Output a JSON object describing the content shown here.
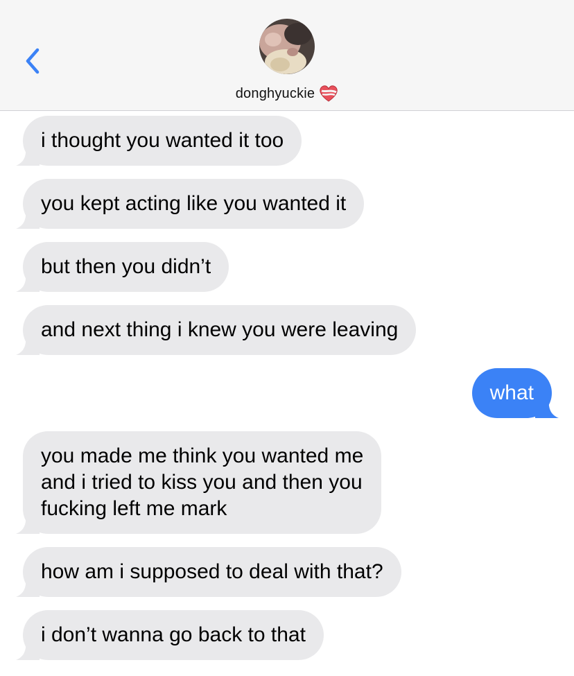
{
  "header": {
    "contact_name": "donghyuckie",
    "back_icon": "chevron-left-icon",
    "heart_icon": "heart-ribbon-icon",
    "accent_color": "#3b82f6"
  },
  "messages": [
    {
      "sender": "contact",
      "text": "i thought you wanted it too"
    },
    {
      "sender": "contact",
      "text": "you kept acting like you wanted it"
    },
    {
      "sender": "contact",
      "text": "but then you didn’t"
    },
    {
      "sender": "contact",
      "text": "and next thing i knew you were leaving"
    },
    {
      "sender": "me",
      "text": "what"
    },
    {
      "sender": "contact",
      "text": "you made me think you wanted me\nand i tried to kiss you and then you\nfucking left me mark"
    },
    {
      "sender": "contact",
      "text": "how am i supposed to deal with that?"
    },
    {
      "sender": "contact",
      "text": "i don’t wanna go back to that"
    }
  ],
  "colors": {
    "received_bubble": "#e9e9eb",
    "sent_bubble": "#3b82f6",
    "header_background": "#f6f6f6"
  }
}
